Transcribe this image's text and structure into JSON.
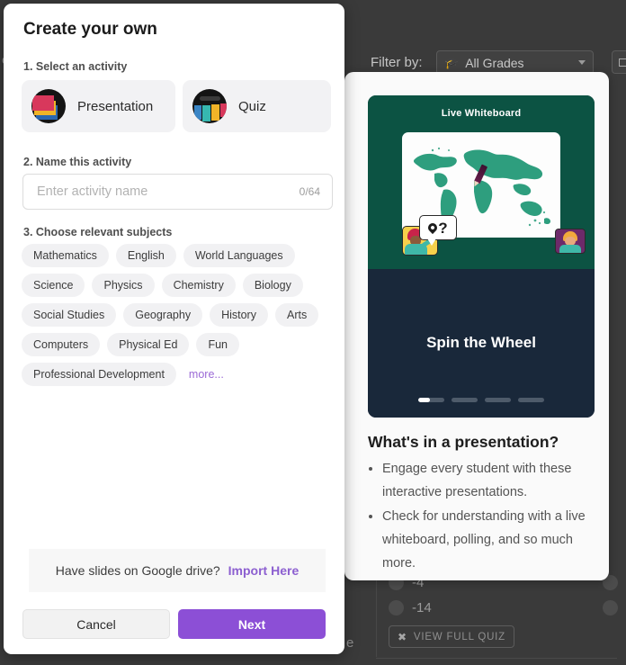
{
  "background": {
    "filter_label": "Filter by:",
    "filter_value": "All Grades",
    "cap_icon": "graduation-cap-icon",
    "grid_icon": "grid-view-icon",
    "left_edge_letter": "c",
    "card_edge_letter": "e",
    "answers": [
      "-4",
      "-14"
    ],
    "view_full_quiz": "VIEW FULL QUIZ",
    "shuffle_icon": "shuffle-icon"
  },
  "modal": {
    "title": "Create your own",
    "step1_label": "1. Select an activity",
    "activities": [
      {
        "label": "Presentation",
        "icon": "presentation-stack-icon",
        "selected": true
      },
      {
        "label": "Quiz",
        "icon": "quiz-bars-icon",
        "selected": false
      }
    ],
    "step2_label": "2. Name this activity",
    "name_value": "",
    "name_placeholder": "Enter activity name",
    "char_count": "0/64",
    "step3_label": "3. Choose relevant subjects",
    "subjects": [
      "Mathematics",
      "English",
      "World Languages",
      "Science",
      "Physics",
      "Chemistry",
      "Biology",
      "Social Studies",
      "Geography",
      "History",
      "Arts",
      "Computers",
      "Physical Ed",
      "Fun",
      "Professional Development"
    ],
    "more_label": "more...",
    "import_question": "Have slides on Google drive?",
    "import_link": "Import Here",
    "cancel_label": "Cancel",
    "next_label": "Next"
  },
  "info_panel": {
    "card_top_title": "Live Whiteboard",
    "card_bottom_title": "Spin the Wheel",
    "pagination_total": 4,
    "pagination_active": 1,
    "heading": "What's in a presentation?",
    "bullets": [
      "Engage every student with these interactive presentations.",
      "Check for understanding with a live whiteboard, polling, and so much more."
    ]
  },
  "colors": {
    "accent_purple": "#8c4fd6",
    "link_purple": "#8c5fd0",
    "card_green": "#0c5343",
    "card_navy": "#19283a",
    "backdrop": "#3a3a3a"
  }
}
